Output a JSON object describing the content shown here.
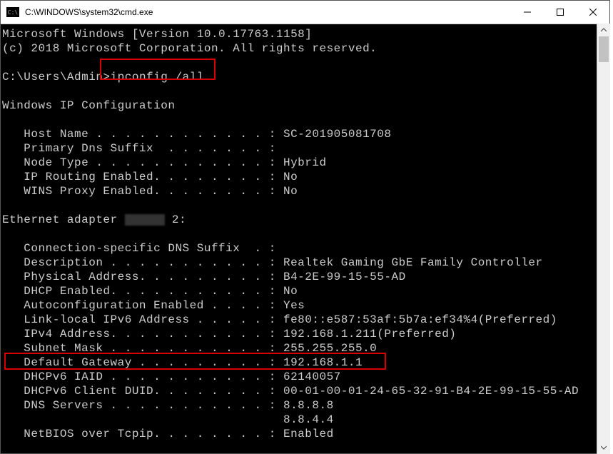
{
  "window": {
    "title": "C:\\WINDOWS\\system32\\cmd.exe"
  },
  "term": {
    "l1": "Microsoft Windows [Version 10.0.17763.1158]",
    "l2": "(c) 2018 Microsoft Corporation. All rights reserved.",
    "prompt": "C:\\Users\\Admin>",
    "cmd": "ipconfig /all",
    "sec1": "Windows IP Configuration",
    "hostname": "   Host Name . . . . . . . . . . . . : SC-201905081708",
    "dnssuffix": "   Primary Dns Suffix  . . . . . . . :",
    "nodetype": "   Node Type . . . . . . . . . . . . : Hybrid",
    "iproute": "   IP Routing Enabled. . . . . . . . : No",
    "winsproxy": "   WINS Proxy Enabled. . . . . . . . : No",
    "adapter_pre": "Ethernet adapter ",
    "adapter_post": " 2:",
    "conspec": "   Connection-specific DNS Suffix  . :",
    "desc": "   Description . . . . . . . . . . . : Realtek Gaming GbE Family Controller",
    "phys": "   Physical Address. . . . . . . . . : B4-2E-99-15-55-AD",
    "dhcp": "   DHCP Enabled. . . . . . . . . . . : No",
    "autoconf": "   Autoconfiguration Enabled . . . . : Yes",
    "linklocal": "   Link-local IPv6 Address . . . . . : fe80::e587:53af:5b7a:ef34%4(Preferred)",
    "ipv4": "   IPv4 Address. . . . . . . . . . . : 192.168.1.211(Preferred)",
    "subnet": "   Subnet Mask . . . . . . . . . . . : 255.255.255.0",
    "gateway": "   Default Gateway . . . . . . . . . : 192.168.1.1",
    "iaid": "   DHCPv6 IAID . . . . . . . . . . . : 62140057",
    "duid": "   DHCPv6 Client DUID. . . . . . . . : 00-01-00-01-24-65-32-91-B4-2E-99-15-55-AD",
    "dns1": "   DNS Servers . . . . . . . . . . . : 8.8.8.8",
    "dns2": "                                       8.8.4.4",
    "netbios": "   NetBIOS over Tcpip. . . . . . . . : Enabled"
  }
}
